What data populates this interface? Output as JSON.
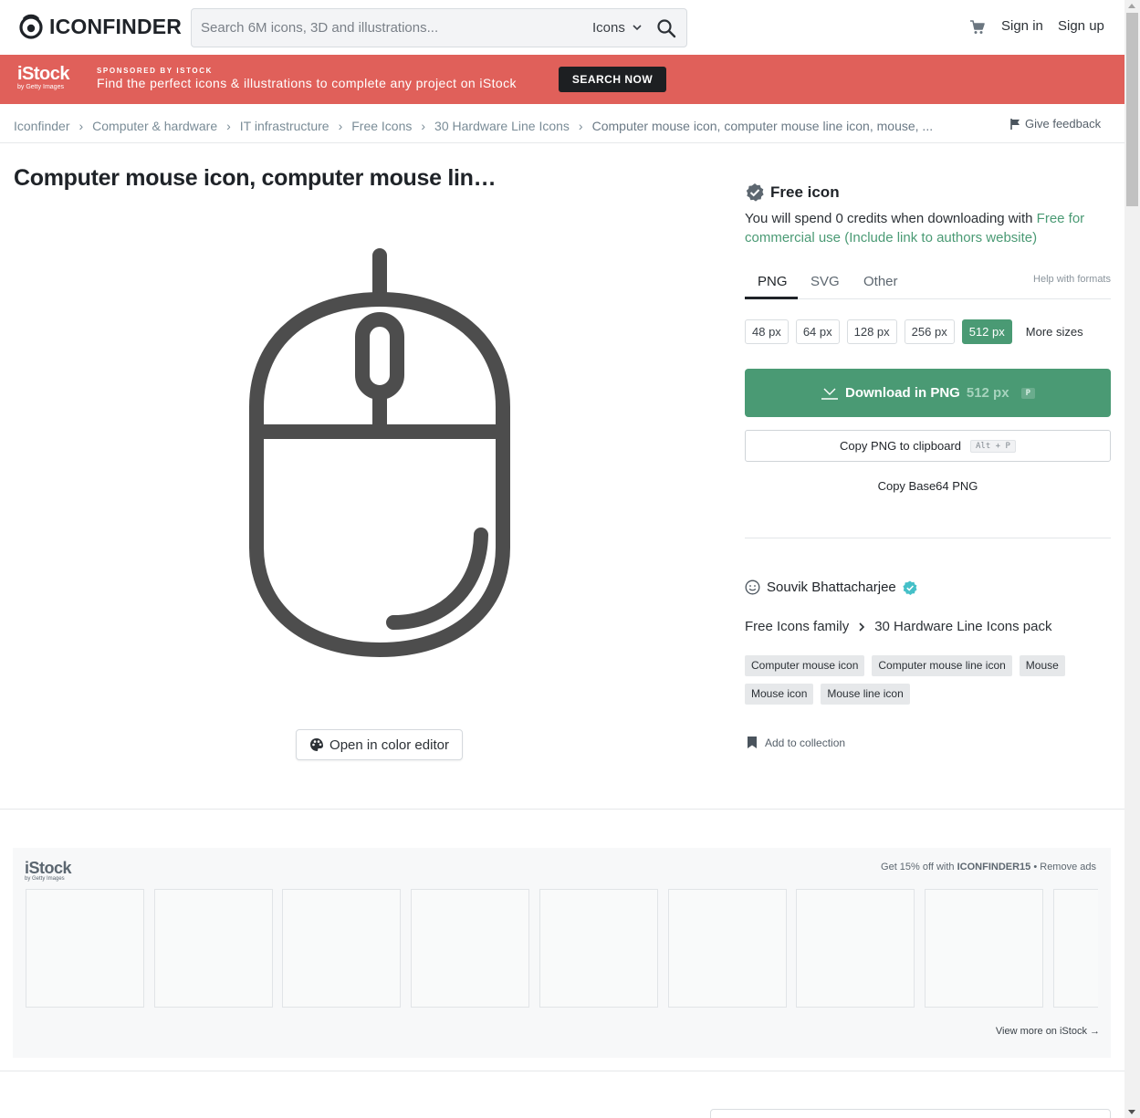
{
  "header": {
    "logo_text": "ICONFINDER",
    "search_placeholder": "Search 6M icons, 3D and illustrations...",
    "search_type": "Icons",
    "sign_in": "Sign in",
    "sign_up": "Sign up"
  },
  "banner": {
    "logo_big": "iStock",
    "logo_small": "by Getty Images",
    "sponsor": "SPONSORED BY ISTOCK",
    "text": "Find the perfect icons & illustrations to complete any project on iStock",
    "button": "SEARCH NOW"
  },
  "breadcrumb": {
    "items": [
      "Iconfinder",
      "Computer & hardware",
      "IT infrastructure",
      "Free Icons",
      "30 Hardware Line Icons"
    ],
    "current": "Computer mouse icon, computer mouse line icon, mouse, ...",
    "feedback": "Give feedback"
  },
  "title": "Computer mouse icon, computer mouse lin…",
  "color_editor": "Open in color editor",
  "panel": {
    "free_label": "Free icon",
    "spend_text": "You will spend 0 credits when downloading with ",
    "license_text": "Free for commercial use (Include link to authors website)",
    "tabs": [
      "PNG",
      "SVG",
      "Other"
    ],
    "help_formats": "Help with formats",
    "sizes": [
      "48 px",
      "64 px",
      "128 px",
      "256 px",
      "512 px"
    ],
    "selected_size": "512 px",
    "more_sizes": "More sizes",
    "download_label": "Download in PNG",
    "download_size": "512 px",
    "download_key": "P",
    "copy_label": "Copy PNG to clipboard",
    "copy_key": "Alt + P",
    "copy_b64": "Copy Base64 PNG",
    "author": "Souvik Bhattacharjee",
    "family": "Free Icons family",
    "pack": "30 Hardware Line Icons pack",
    "tags": [
      "Computer mouse icon",
      "Computer mouse line icon",
      "Mouse",
      "Mouse icon",
      "Mouse line icon"
    ],
    "add_collection": "Add to collection"
  },
  "ad": {
    "logo_big": "iStock",
    "logo_small": "by Getty Images",
    "promo_prefix": "Get 15% off with ",
    "promo_code": "ICONFINDER15",
    "promo_suffix": " • Remove ads",
    "view_more": "View more on iStock →"
  },
  "colors": {
    "accent_green": "#4a9a74",
    "banner_red": "#e0605a",
    "icon_stroke": "#4d4d4d"
  }
}
